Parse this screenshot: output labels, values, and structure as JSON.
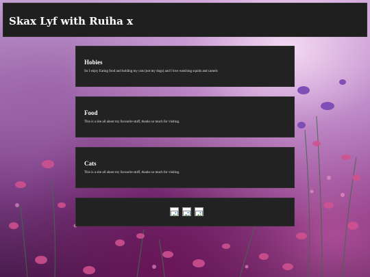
{
  "header": {
    "title": "Skax Lyf with Ruiha x"
  },
  "sections": [
    {
      "title": "Hobies",
      "text": "So I enjoy Eating food and holding my cats (not my dogs) and I love watching squids and camels"
    },
    {
      "title": "Food",
      "text": "This is a site all about my favourite stuff, thanks so much for visiting."
    },
    {
      "title": "Cats",
      "text": "This is a site all about my favourite stuff, thanks so much for visiting."
    }
  ],
  "footer": {
    "icons": [
      "broken-image-icon",
      "broken-image-icon",
      "broken-image-icon"
    ]
  }
}
